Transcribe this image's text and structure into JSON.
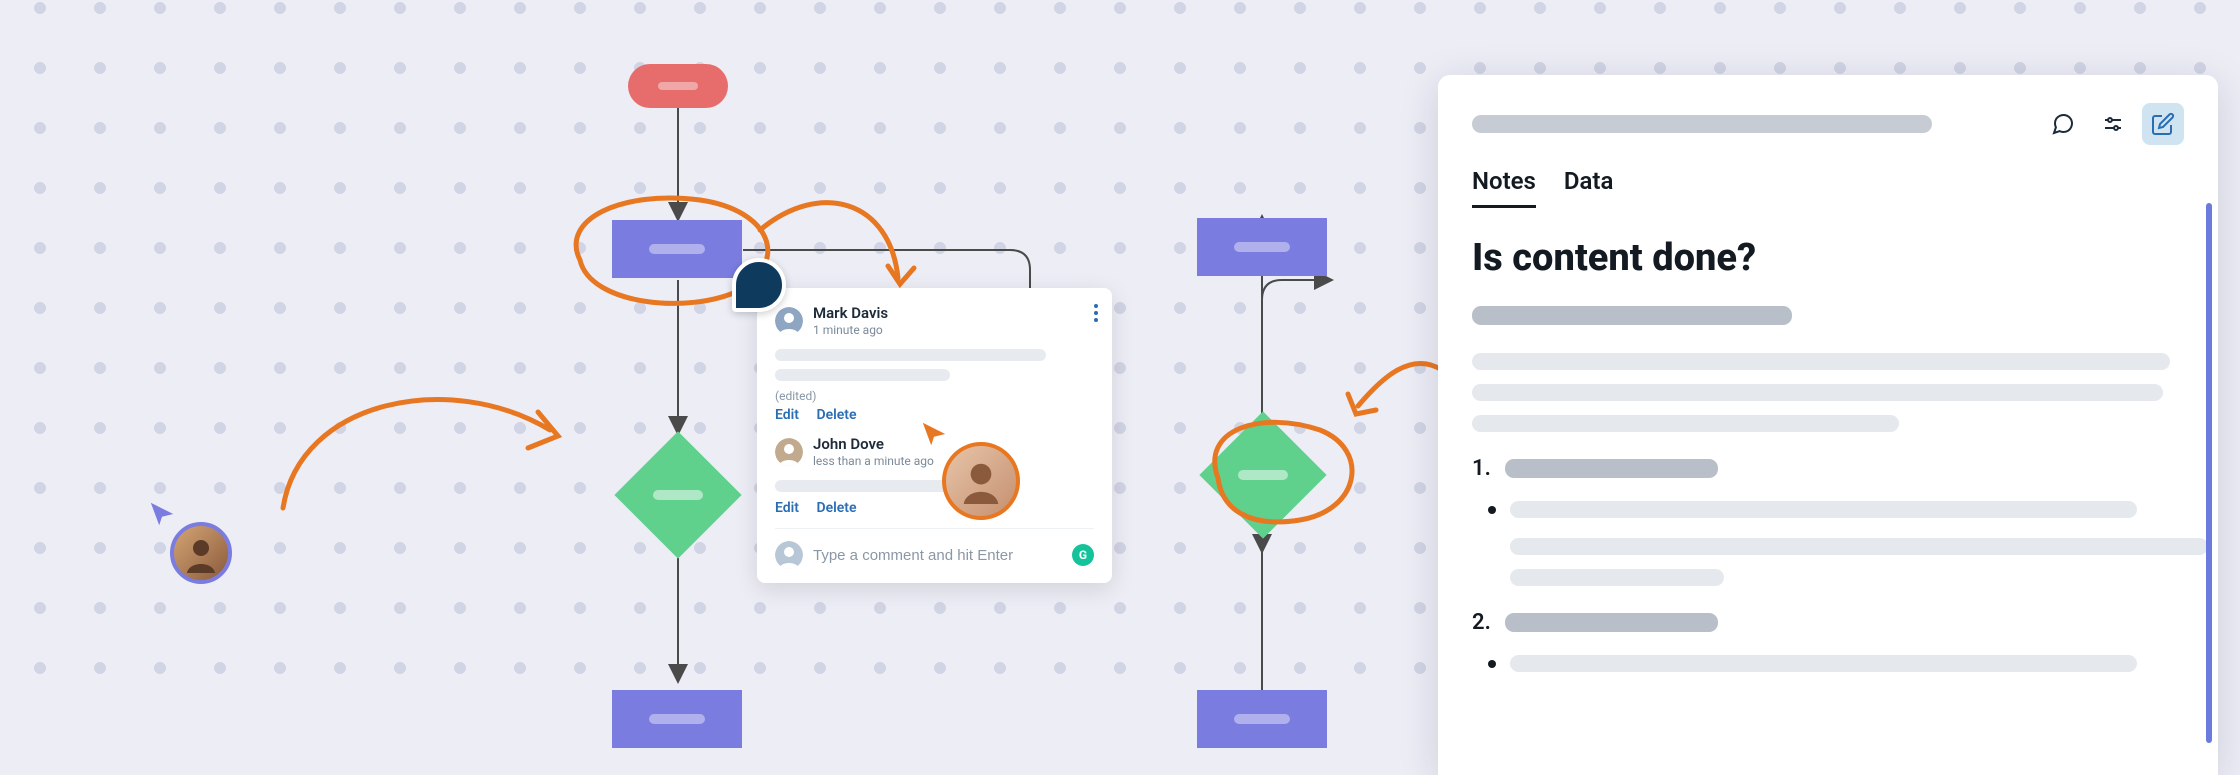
{
  "comments": {
    "thread": [
      {
        "author": "Mark Davis",
        "timestamp": "1 minute ago",
        "edited_label": "(edited)",
        "actions": {
          "edit": "Edit",
          "delete": "Delete"
        }
      },
      {
        "author": "John Dove",
        "timestamp": "less than a minute ago",
        "actions": {
          "edit": "Edit",
          "delete": "Delete"
        }
      }
    ],
    "input_placeholder": "Type a comment and hit Enter"
  },
  "notes_panel": {
    "tabs": {
      "notes": "Notes",
      "data": "Data"
    },
    "active_tab": "Notes",
    "heading": "Is content done?",
    "ordered_markers": {
      "one": "1.",
      "two": "2."
    }
  },
  "cursors": {
    "purple": {
      "color": "#7A7CE0"
    },
    "orange": {
      "color": "#E87722"
    },
    "green": {
      "color": "#3EBD70"
    },
    "red": {
      "color": "#E24B4B"
    }
  },
  "icons": {
    "chat": "chat-icon",
    "sliders": "sliders-icon",
    "edit": "edit-note-icon",
    "grammarly": "G"
  }
}
